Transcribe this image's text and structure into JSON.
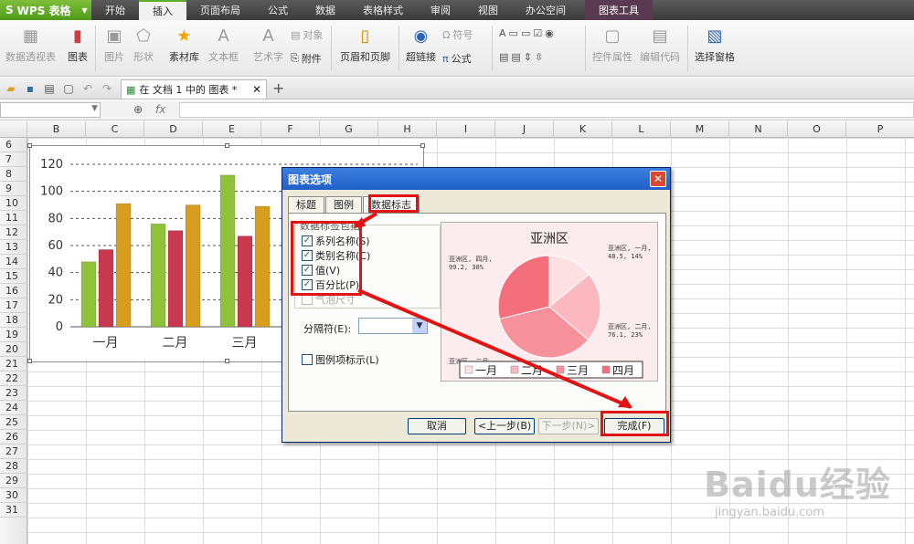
{
  "app": {
    "name": "WPS 表格"
  },
  "menu": [
    "开始",
    "插入",
    "页面布局",
    "公式",
    "数据",
    "表格样式",
    "审阅",
    "视图",
    "办公空间",
    "图表工具"
  ],
  "ribbon": {
    "pivot": "数据透视表",
    "chart": "图表",
    "picture": "图片",
    "shape": "形状",
    "library": "素材库",
    "textbox": "文本框",
    "wordart": "艺术字",
    "object": "对象",
    "attachment": "附件",
    "header_footer": "页眉和页脚",
    "hyperlink": "超链接",
    "symbol": "符号",
    "formula": "公式",
    "control_props": "控件属性",
    "edit_code": "编辑代码",
    "select_pane": "选择窗格"
  },
  "doc_tab": {
    "label": "在 文档 1 中的 图表 *"
  },
  "formula_bar": {
    "fx": "fx"
  },
  "columns": [
    "B",
    "C",
    "D",
    "E",
    "F",
    "G",
    "H",
    "I",
    "J",
    "K",
    "L",
    "M",
    "N",
    "O",
    "P"
  ],
  "rows": [
    "6",
    "7",
    "8",
    "9",
    "10",
    "11",
    "12",
    "13",
    "14",
    "15",
    "16",
    "17",
    "18",
    "19",
    "20",
    "21",
    "22",
    "23",
    "24",
    "25",
    "26",
    "27",
    "28",
    "29",
    "30",
    "31"
  ],
  "chart_data": [
    {
      "type": "bar",
      "categories": [
        "一月",
        "二月",
        "三月"
      ],
      "series": [
        {
          "values": [
            48,
            76,
            112
          ],
          "color": "#8fc23a"
        },
        {
          "values": [
            57,
            71,
            67
          ],
          "color": "#c8384e"
        },
        {
          "values": [
            91,
            90,
            89
          ],
          "color": "#d79d1f"
        }
      ],
      "yticks": [
        "0",
        "20",
        "40",
        "60",
        "80",
        "100",
        "120"
      ],
      "ylim": [
        0,
        120
      ],
      "grid": true
    },
    {
      "type": "pie",
      "title": "亚洲区",
      "legend": [
        "一月",
        "二月",
        "三月",
        "四月"
      ],
      "values": [
        48.5,
        76.1,
        120,
        99.2
      ],
      "colors": [
        "#fde0e2",
        "#fbb8bf",
        "#f7919b",
        "#f26f7b"
      ],
      "labels": [
        "亚洲区, 一月, 48.5, 14%",
        "亚洲区, 二月, 76.1, 23%",
        "亚洲区, 三月",
        "亚洲区, 四月, 99.2, 30%"
      ],
      "legend_placement": "bottom"
    }
  ],
  "dialog": {
    "title": "图表选项",
    "tabs": [
      "标题",
      "图例",
      "数据标志"
    ],
    "group_label": "数据标签包括",
    "checkboxes": [
      {
        "label": "系列名称(S)",
        "checked": true
      },
      {
        "label": "类别名称(C)",
        "checked": true
      },
      {
        "label": "值(V)",
        "checked": true
      },
      {
        "label": "百分比(P)",
        "checked": true
      },
      {
        "label": "气泡尺寸",
        "checked": false
      }
    ],
    "separator_label": "分隔符(E):",
    "legend_key_label": "图例项标示(L)",
    "buttons": {
      "cancel": "取消",
      "back": "<上一步(B)",
      "next": "下一步(N)>",
      "finish": "完成(F)"
    }
  },
  "watermark": {
    "brand": "Baidu经验",
    "url": "jingyan.baidu.com"
  }
}
